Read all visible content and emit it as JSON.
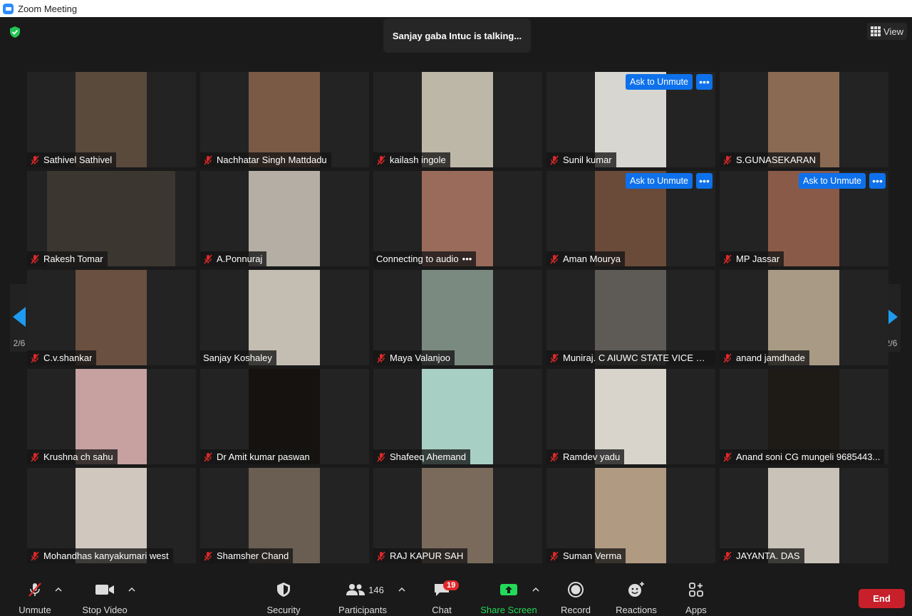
{
  "window": {
    "title": "Zoom Meeting"
  },
  "meeting": {
    "talking_indicator": "Sanjay gaba Intuc is talking...",
    "view_label": "View",
    "pagination": {
      "left": "2/6",
      "right": "2/6"
    }
  },
  "participants": [
    {
      "name": "Sathivel Sathivel",
      "muted": true,
      "bg": "#5a4a3c",
      "wide": false
    },
    {
      "name": "Nachhatar Singh Mattdadu",
      "muted": true,
      "bg": "#7a5a45",
      "wide": false
    },
    {
      "name": "kailash ingole",
      "muted": true,
      "bg": "#bdb7a8",
      "wide": false
    },
    {
      "name": "Sunil kumar",
      "muted": true,
      "bg": "#d8d6d0",
      "wide": false,
      "ask_unmute": "Ask to Unmute"
    },
    {
      "name": "S.GUNASEKARAN",
      "muted": true,
      "bg": "#8a6a52",
      "wide": false
    },
    {
      "name": "Rakesh Tomar",
      "muted": true,
      "bg": "#3b3630",
      "wide": true
    },
    {
      "name": "A.Ponnuraj",
      "muted": true,
      "bg": "#b5aea4",
      "wide": false
    },
    {
      "name": "Connecting to audio",
      "muted": false,
      "bg": "#9a6a5a",
      "wide": false,
      "connecting": true
    },
    {
      "name": "Aman Mourya",
      "muted": true,
      "bg": "#6a4a38",
      "wide": false,
      "ask_unmute": "Ask to Unmute"
    },
    {
      "name": "MP Jassar",
      "muted": true,
      "bg": "#8a5a48",
      "wide": false,
      "ask_unmute": "Ask to Unmute"
    },
    {
      "name": "C.v.shankar",
      "muted": true,
      "bg": "#6a5040",
      "wide": false
    },
    {
      "name": "Sanjay Koshaley",
      "muted": false,
      "bg": "#c4bdb2",
      "wide": false
    },
    {
      "name": "Maya Valanjoo",
      "muted": true,
      "bg": "#7a8a80",
      "wide": false
    },
    {
      "name": "Muniraj. C AIUWC STATE VICE PRE...",
      "muted": true,
      "bg": "#5e5a55",
      "wide": false
    },
    {
      "name": "anand jamdhade",
      "muted": true,
      "bg": "#a89a85",
      "wide": false
    },
    {
      "name": "Krushna ch sahu",
      "muted": true,
      "bg": "#c7a0a0",
      "wide": false
    },
    {
      "name": "Dr Amit kumar paswan",
      "muted": true,
      "bg": "#15120f",
      "wide": false
    },
    {
      "name": "Shafeeq Ahemand",
      "muted": true,
      "bg": "#a8cfc4",
      "wide": false
    },
    {
      "name": "Ramdev yadu",
      "muted": true,
      "bg": "#d8d4cc",
      "wide": false
    },
    {
      "name": "Anand soni CG mungeli 9685443...",
      "muted": true,
      "bg": "#1e1a16",
      "wide": false
    },
    {
      "name": "Mohandhas kanyakumari west",
      "muted": true,
      "bg": "#d0c7be",
      "wide": false
    },
    {
      "name": "Shamsher Chand",
      "muted": true,
      "bg": "#6a5d52",
      "wide": false
    },
    {
      "name": "RAJ KAPUR SAH",
      "muted": true,
      "bg": "#7a6a5c",
      "wide": false
    },
    {
      "name": "Suman Verma",
      "muted": true,
      "bg": "#b09a82",
      "wide": false
    },
    {
      "name": "JAYANTA. DAS",
      "muted": true,
      "bg": "#c8c2b8",
      "wide": false
    }
  ],
  "toolbar": {
    "unmute": "Unmute",
    "stop_video": "Stop Video",
    "security": "Security",
    "participants": "Participants",
    "participants_count": "146",
    "chat": "Chat",
    "chat_badge": "19",
    "share_screen": "Share Screen",
    "record": "Record",
    "reactions": "Reactions",
    "apps": "Apps",
    "end": "End"
  },
  "colors": {
    "accent_blue": "#0e71eb",
    "share_green": "#23d959",
    "end_red": "#c7202b",
    "mute_red": "#e02828"
  }
}
